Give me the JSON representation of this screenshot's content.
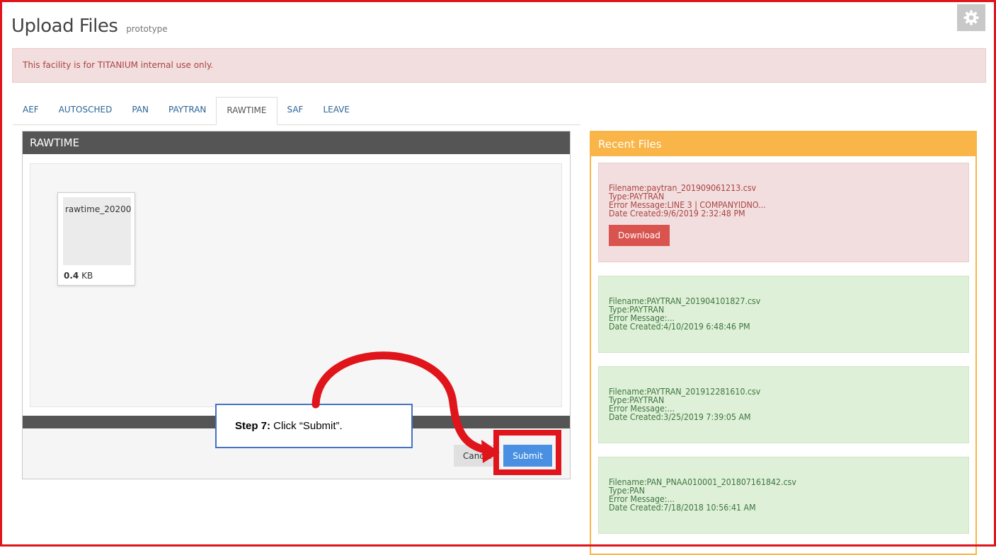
{
  "header": {
    "title": "Upload Files",
    "subtitle": "prototype",
    "settings_icon": "gear-icon"
  },
  "alert": {
    "text": "This facility is for TITANIUM internal use only.",
    "color": "#a94442"
  },
  "tabs": [
    {
      "label": "AEF",
      "active": false
    },
    {
      "label": "AUTOSCHED",
      "active": false
    },
    {
      "label": "PAN",
      "active": false
    },
    {
      "label": "PAYTRAN",
      "active": false
    },
    {
      "label": "RAWTIME",
      "active": true
    },
    {
      "label": "SAF",
      "active": false
    },
    {
      "label": "LEAVE",
      "active": false
    }
  ],
  "upload_panel": {
    "title": "RAWTIME",
    "file": {
      "name": "rawtime_20200",
      "size_value": "0.4",
      "size_unit": "KB"
    },
    "cancel_label": "Cancel",
    "submit_label": "Submit"
  },
  "recent_files": {
    "title": "Recent Files",
    "items": [
      {
        "status": "error",
        "filename": "Filename:paytran_201909061213.csv",
        "type": "Type:PAYTRAN",
        "error": "Error Message:LINE 3 | COMPANYIDNO...",
        "date": "Date Created:9/6/2019 2:32:48 PM",
        "download_label": "Download"
      },
      {
        "status": "ok",
        "filename": "Filename:PAYTRAN_201904101827.csv",
        "type": "Type:PAYTRAN",
        "error": "Error Message:...",
        "date": "Date Created:4/10/2019 6:48:46 PM"
      },
      {
        "status": "ok",
        "filename": "Filename:PAYTRAN_201912281610.csv",
        "type": "Type:PAYTRAN",
        "error": "Error Message:...",
        "date": "Date Created:3/25/2019 7:39:05 AM"
      },
      {
        "status": "ok",
        "filename": "Filename:PAN_PNAA010001_201807161842.csv",
        "type": "Type:PAN",
        "error": "Error Message:...",
        "date": "Date Created:7/18/2018 10:56:41 AM"
      }
    ]
  },
  "callout": {
    "step_label": "Step 7:",
    "text": " Click “Submit”."
  },
  "colors": {
    "annotation_red": "#e0141b",
    "callout_border": "#4472c4",
    "accent_orange": "#f9b548",
    "submit_blue": "#4a90e2"
  }
}
